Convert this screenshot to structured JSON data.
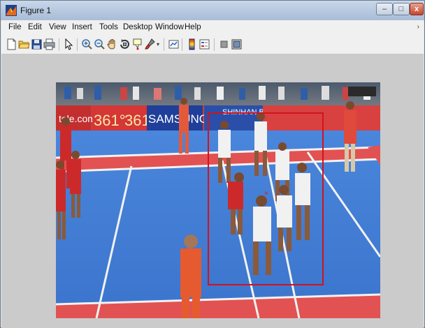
{
  "window": {
    "title": "Figure 1",
    "controls": {
      "minimize": "–",
      "maximize": "□",
      "close": "x"
    }
  },
  "menubar": {
    "items": [
      "File",
      "Edit",
      "View",
      "Insert",
      "Tools",
      "Desktop",
      "Window",
      "Help"
    ],
    "overflow_icon": "chevron-right-icon"
  },
  "toolbar": {
    "icons": [
      "new-figure-icon",
      "open-file-icon",
      "save-icon",
      "print-icon",
      "select-arrow-icon",
      "zoom-in-icon",
      "zoom-out-icon",
      "pan-hand-icon",
      "rotate-3d-icon",
      "data-cursor-icon",
      "brush-icon",
      "link-plot-icon",
      "colorbar-icon",
      "legend-icon",
      "hide-plot-tools-icon",
      "show-plot-tools-icon"
    ]
  },
  "figure": {
    "image_description_hidden": "",
    "banner_text": [
      "tele.com",
      "361°",
      "361°",
      "SAMSUNG",
      "SHINHAN BANK"
    ],
    "detection_box_color": "#d2131b",
    "marker_color": "#e01818",
    "court_color": "#3d7bd6",
    "line_color": "#f2f2f2"
  },
  "colors": {
    "titlebar": "#b9cbe1",
    "menubar": "#f0f0f0",
    "figure_background": "#cbcbcb"
  }
}
